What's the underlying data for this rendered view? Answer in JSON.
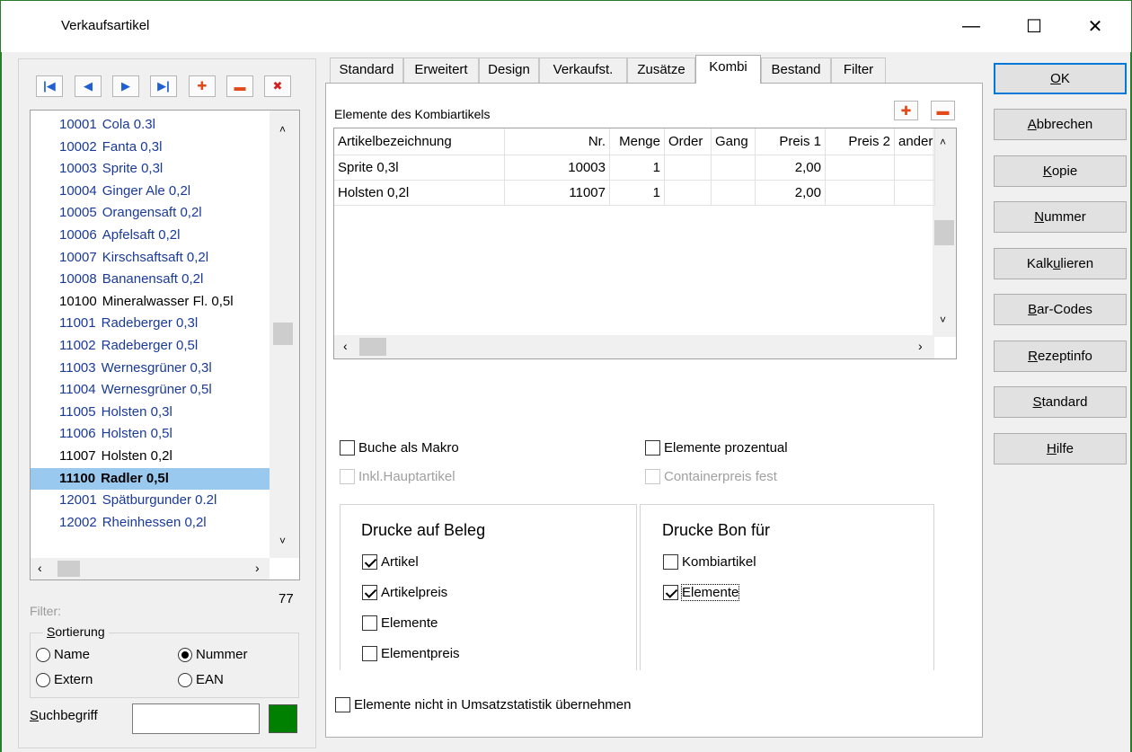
{
  "window": {
    "title": "Verkaufsartikel",
    "minimize": "—",
    "maximize": "☐",
    "close": "✕"
  },
  "nav": {
    "first": "|◀",
    "prev": "◀",
    "next": "▶",
    "last": "▶|",
    "add": "✚",
    "remove": "▬",
    "delete": "✖"
  },
  "list": {
    "items": [
      {
        "num": "10001",
        "name": "Cola 0.3l",
        "color": "#1a3a9a"
      },
      {
        "num": "10002",
        "name": "Fanta 0,3l",
        "color": "#1a3a9a"
      },
      {
        "num": "10003",
        "name": "Sprite 0,3l",
        "color": "#1a3a9a"
      },
      {
        "num": "10004",
        "name": "Ginger Ale 0,2l",
        "color": "#1a3a9a"
      },
      {
        "num": "10005",
        "name": "Orangensaft 0,2l",
        "color": "#1a3a9a"
      },
      {
        "num": "10006",
        "name": "Apfelsaft 0,2l",
        "color": "#1a3a9a"
      },
      {
        "num": "10007",
        "name": "Kirschsaftsaft 0,2l",
        "color": "#1a3a9a"
      },
      {
        "num": "10008",
        "name": "Bananensaft 0,2l",
        "color": "#1a3a9a"
      },
      {
        "num": "10100",
        "name": "Mineralwasser Fl. 0,5l",
        "color": "#000000"
      },
      {
        "num": "11001",
        "name": "Radeberger 0,3l",
        "color": "#1a3a9a"
      },
      {
        "num": "11002",
        "name": "Radeberger 0,5l",
        "color": "#1a3a9a"
      },
      {
        "num": "11003",
        "name": "Wernesgrüner 0,3l",
        "color": "#1a3a9a"
      },
      {
        "num": "11004",
        "name": "Wernesgrüner 0,5l",
        "color": "#1a3a9a"
      },
      {
        "num": "11005",
        "name": "Holsten 0,3l",
        "color": "#1a3a9a"
      },
      {
        "num": "11006",
        "name": "Holsten 0,5l",
        "color": "#1a3a9a"
      },
      {
        "num": "11007",
        "name": "Holsten 0,2l",
        "color": "#000000"
      },
      {
        "num": "11100",
        "name": "Radler 0,5l",
        "color": "#000000",
        "selected": true
      },
      {
        "num": "12001",
        "name": "Spätburgunder 0.2l",
        "color": "#1a3a9a"
      },
      {
        "num": "12002",
        "name": "Rheinhessen 0,2l",
        "color": "#1a3a9a"
      }
    ],
    "count": "77",
    "selected_bg": "#99c9ef"
  },
  "filter_label": "Filter:",
  "sort": {
    "legend": "Sortierung",
    "options": [
      {
        "label": "Name",
        "checked": false
      },
      {
        "label": "Nummer",
        "checked": true
      },
      {
        "label": "Extern",
        "checked": false
      },
      {
        "label": "EAN",
        "checked": false
      }
    ]
  },
  "search": {
    "label": "Suchbegriff",
    "value": ""
  },
  "tabs": [
    "Standard",
    "Erweitert",
    "Design",
    "Verkaufst.",
    "Zusätze",
    "Kombi",
    "Bestand",
    "Filter"
  ],
  "active_tab": "Kombi",
  "kombi": {
    "section_label": "Elemente des Kombiartikels",
    "columns": [
      "Artikelbezeichnung",
      "Nr.",
      "Menge",
      "Order",
      "Gang",
      "Preis 1",
      "Preis 2",
      "ander"
    ],
    "rows": [
      [
        "Sprite 0,3l",
        "10003",
        "1",
        "",
        "",
        "2,00",
        "",
        ""
      ],
      [
        "Holsten 0,2l",
        "11007",
        "1",
        "",
        "",
        "2,00",
        "",
        ""
      ]
    ],
    "options": {
      "buche_als_makro": {
        "label": "Buche als Makro",
        "checked": false
      },
      "elemente_prozentual": {
        "label": "Elemente prozentual",
        "checked": false
      },
      "inkl_hauptartikel": {
        "label": "Inkl.Hauptartikel",
        "checked": false
      },
      "containerpreis_fest": {
        "label": "Containerpreis fest",
        "checked": false
      }
    },
    "drucke_auf_beleg": {
      "title": "Drucke auf Beleg",
      "items": [
        {
          "label": "Artikel",
          "checked": true
        },
        {
          "label": "Artikelpreis",
          "checked": true
        },
        {
          "label": "Elemente",
          "checked": false
        },
        {
          "label": "Elementpreis",
          "checked": false
        }
      ]
    },
    "drucke_bon": {
      "title": "Drucke Bon für",
      "items": [
        {
          "label": "Kombiartikel",
          "checked": false
        },
        {
          "label": "Elemente",
          "checked": true
        }
      ]
    },
    "umsatz": {
      "label": "Elemente nicht in Umsatzstatistik übernehmen",
      "checked": false
    }
  },
  "side_buttons": [
    {
      "pre": "",
      "u": "O",
      "post": "K"
    },
    {
      "pre": "",
      "u": "A",
      "post": "bbrechen"
    },
    {
      "pre": "",
      "u": "K",
      "post": "opie"
    },
    {
      "pre": "",
      "u": "N",
      "post": "ummer"
    },
    {
      "pre": "Kalk",
      "u": "u",
      "post": "lieren"
    },
    {
      "pre": "",
      "u": "B",
      "post": "ar-Codes"
    },
    {
      "pre": "",
      "u": "R",
      "post": "ezeptinfo"
    },
    {
      "pre": "",
      "u": "S",
      "post": "tandard"
    },
    {
      "pre": "",
      "u": "H",
      "post": "ilfe"
    }
  ]
}
